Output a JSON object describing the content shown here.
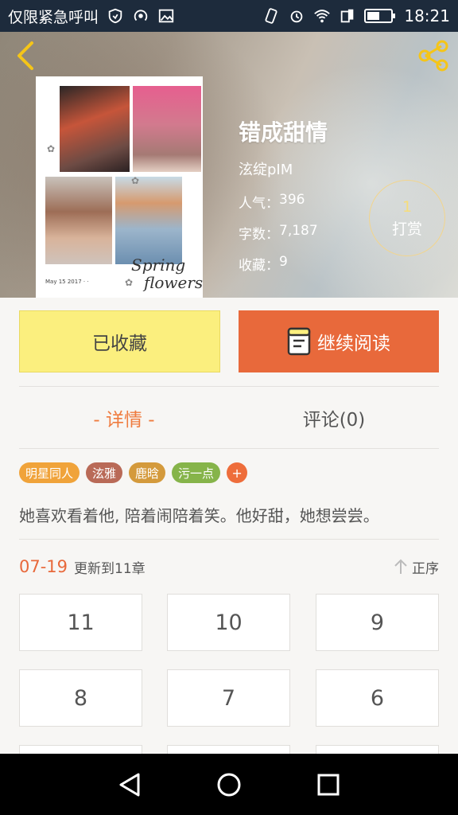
{
  "status_bar": {
    "carrier": "仅限紧急呼叫",
    "time": "18:21",
    "battery_level": 0.55
  },
  "header": {
    "back_icon": "chevron-left-icon",
    "share_icon": "share-icon",
    "accent": "#f5c518"
  },
  "cover": {
    "script_line1": "Spring",
    "script_line2": "flowers",
    "small_text": "May 15 2017 · ·"
  },
  "book": {
    "title": "错成甜情",
    "author": "泫绽pIM",
    "popularity_label": "人气：",
    "popularity": "396",
    "words_label": "字数：",
    "words": "7,187",
    "favorites_label": "收藏：",
    "favorites": "9"
  },
  "reward": {
    "count": "1",
    "label": "打赏"
  },
  "actions": {
    "collected_label": "已收藏",
    "read_label": "继续阅读",
    "read_icon": "book-icon",
    "collected_color": "#fbef7e",
    "read_color": "#e8693b"
  },
  "tabs": [
    {
      "label": "- 详情 -",
      "active": true
    },
    {
      "label": "评论(0)",
      "active": false
    }
  ],
  "tags": [
    {
      "label": "明星同人",
      "color": "#f0a33a"
    },
    {
      "label": "泫雅",
      "color": "#b96a57"
    },
    {
      "label": "鹿晗",
      "color": "#d49a3c"
    },
    {
      "label": "污一点",
      "color": "#86b44a"
    }
  ],
  "tag_add": "+",
  "description": "她喜欢看着他, 陪着闹陪着笑。他好甜，她想尝尝。",
  "update": {
    "date": "07-19",
    "text": "更新到11章",
    "sort_label": "正序",
    "sort_icon": "arrow-up-icon"
  },
  "chapters": [
    "11",
    "10",
    "9",
    "8",
    "7",
    "6",
    "",
    "",
    ""
  ],
  "nav": {
    "back": "triangle-back-icon",
    "home": "circle-home-icon",
    "recents": "square-recents-icon"
  }
}
